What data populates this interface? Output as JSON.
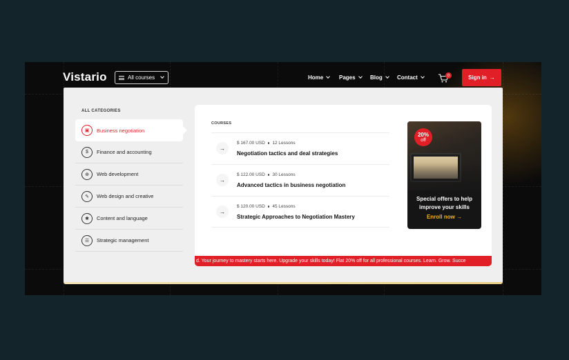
{
  "header": {
    "logo": "Vistario",
    "all_courses_label": "All courses",
    "nav": [
      {
        "label": "Home"
      },
      {
        "label": "Pages"
      },
      {
        "label": "Blog"
      },
      {
        "label": "Contact"
      }
    ],
    "cart_count": "0",
    "signin_label": "Sign in"
  },
  "categories": {
    "heading": "ALL CATEGORIES",
    "items": [
      {
        "label": "Business negotiation",
        "icon": "briefcase-icon",
        "glyph": "▣",
        "active": true
      },
      {
        "label": "Finance and accounting",
        "icon": "finance-icon",
        "glyph": "$",
        "active": false
      },
      {
        "label": "Web development",
        "icon": "globe-icon",
        "glyph": "⊕",
        "active": false
      },
      {
        "label": "Web design and creative",
        "icon": "design-icon",
        "glyph": "✎",
        "active": false
      },
      {
        "label": "Content and language",
        "icon": "language-icon",
        "glyph": "✱",
        "active": false
      },
      {
        "label": "Strategic management",
        "icon": "strategy-icon",
        "glyph": "☰",
        "active": false
      }
    ]
  },
  "courses": {
    "heading": "COURSES",
    "items": [
      {
        "price": "$ 167.00 USD",
        "lessons": "12 Lessons",
        "title": "Negotiation tactics and deal strategies"
      },
      {
        "price": "$ 122.00 USD",
        "lessons": "30 Lessons",
        "title": "Advanced tactics in business negotiation"
      },
      {
        "price": "$ 120.00 USD",
        "lessons": "45 Lessons",
        "title": "Strategic Approaches to Negotiation Mastery"
      }
    ]
  },
  "promo": {
    "badge_pct": "20%",
    "badge_off": "off",
    "text": "Special offers to help improve your skills",
    "cta": "Enroll now"
  },
  "ticker": {
    "text": "d.  Your journey to mastery starts here.  Upgrade your skills today!  Flat 20% off for all professional courses.  Learn. Grow. Succe"
  },
  "colors": {
    "accent": "#e01f26",
    "promo_cta": "#f3b21a",
    "page_bg": "#13252a"
  }
}
